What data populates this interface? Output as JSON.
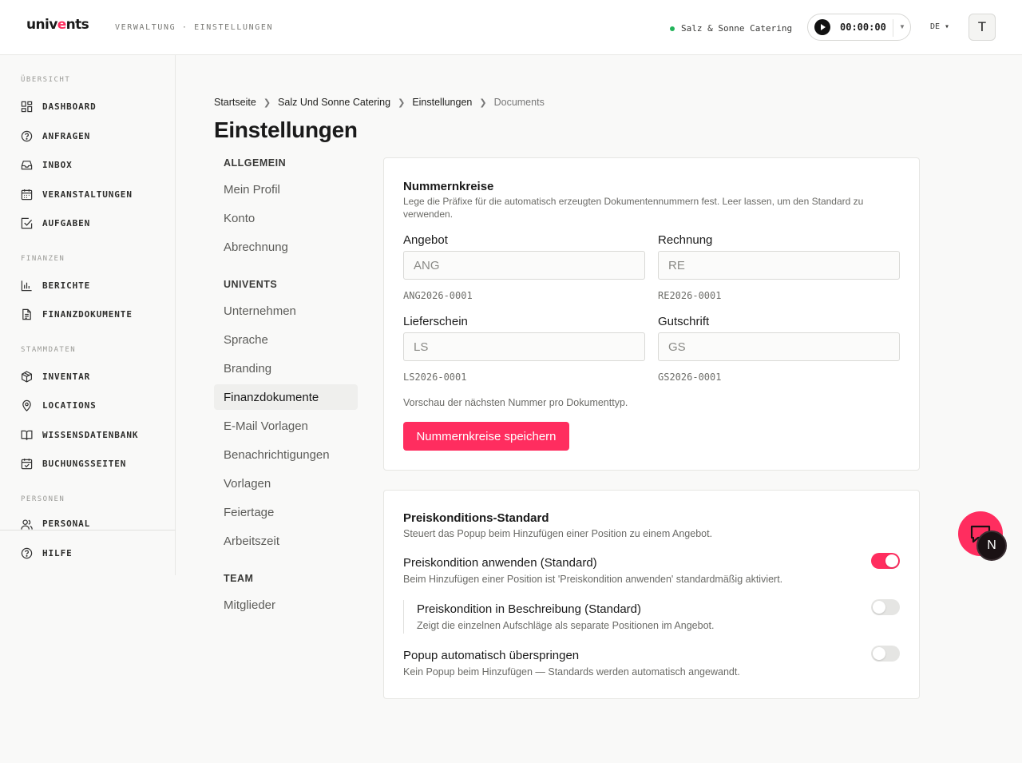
{
  "header": {
    "logo_prefix": "univ",
    "logo_accent": "e",
    "logo_suffix": "nts",
    "breadcrumb": "VERWALTUNG · EINSTELLUNGEN",
    "company": "Salz & Sonne Catering",
    "timer": "00:00:00",
    "language": "DE ▾",
    "avatar_initial": "T"
  },
  "sidebar": {
    "groups": [
      {
        "label": "ÜBERSICHT"
      },
      {
        "label": "FINANZEN"
      },
      {
        "label": "STAMMDATEN"
      },
      {
        "label": "PERSONEN"
      }
    ],
    "items": [
      {
        "label": "DASHBOARD",
        "icon": "dashboard-icon"
      },
      {
        "label": "ANFRAGEN",
        "icon": "question-icon"
      },
      {
        "label": "INBOX",
        "icon": "inbox-icon"
      },
      {
        "label": "VERANSTALTUNGEN",
        "icon": "calendar-icon"
      },
      {
        "label": "AUFGABEN",
        "icon": "checkbox-icon"
      },
      {
        "label": "BERICHTE",
        "icon": "bar-chart-icon"
      },
      {
        "label": "FINANZDOKUMENTE",
        "icon": "document-icon"
      },
      {
        "label": "INVENTAR",
        "icon": "box-icon"
      },
      {
        "label": "LOCATIONS",
        "icon": "map-pin-icon"
      },
      {
        "label": "WISSENSDATENBANK",
        "icon": "book-icon"
      },
      {
        "label": "BUCHUNGSSEITEN",
        "icon": "calendar-check-icon"
      },
      {
        "label": "PERSONAL",
        "icon": "users-icon"
      },
      {
        "label": "HILFE",
        "icon": "help-icon"
      }
    ]
  },
  "breadcrumb": {
    "items": [
      "Startseite",
      "Salz Und Sonne Catering",
      "Einstellungen",
      "Documents"
    ]
  },
  "page": {
    "title": "Einstellungen"
  },
  "settings_nav": {
    "sections": [
      {
        "heading": "ALLGEMEIN",
        "items": [
          "Mein Profil",
          "Konto",
          "Abrechnung"
        ]
      },
      {
        "heading": "UNIVENTS",
        "items": [
          "Unternehmen",
          "Sprache",
          "Branding",
          "Finanzdokumente",
          "E-Mail Vorlagen",
          "Benachrichtigungen",
          "Vorlagen",
          "Feiertage",
          "Arbeitszeit"
        ]
      },
      {
        "heading": "TEAM",
        "items": [
          "Mitglieder"
        ]
      }
    ],
    "active": "Finanzdokumente"
  },
  "number_ranges": {
    "title": "Nummernkreise",
    "description": "Lege die Präfixe für die automatisch erzeugten Dokumentennummern fest. Leer lassen, um den Standard zu verwenden.",
    "fields": [
      {
        "label": "Angebot",
        "placeholder": "ANG",
        "preview": "ANG2026-0001"
      },
      {
        "label": "Rechnung",
        "placeholder": "RE",
        "preview": "RE2026-0001"
      },
      {
        "label": "Lieferschein",
        "placeholder": "LS",
        "preview": "LS2026-0001"
      },
      {
        "label": "Gutschrift",
        "placeholder": "GS",
        "preview": "GS2026-0001"
      }
    ],
    "preview_note": "Vorschau der nächsten Nummer pro Dokumenttyp.",
    "save_label": "Nummernkreise speichern"
  },
  "price_conditions": {
    "title": "Preiskonditions-Standard",
    "description": "Steuert das Popup beim Hinzufügen einer Position zu einem Angebot.",
    "options": [
      {
        "title": "Preiskondition anwenden (Standard)",
        "description": "Beim Hinzufügen einer Position ist 'Preiskondition anwenden' standardmäßig aktiviert.",
        "enabled": true
      },
      {
        "title": "Preiskondition in Beschreibung (Standard)",
        "description": "Zeigt die einzelnen Aufschläge als separate Positionen im Angebot.",
        "enabled": false
      },
      {
        "title": "Popup automatisch überspringen",
        "description": "Kein Popup beim Hinzufügen — Standards werden automatisch angewandt.",
        "enabled": false
      }
    ]
  },
  "floating": {
    "badge_letter": "N"
  },
  "colors": {
    "accent": "#ff2d5f",
    "status_online": "#22b35a"
  }
}
